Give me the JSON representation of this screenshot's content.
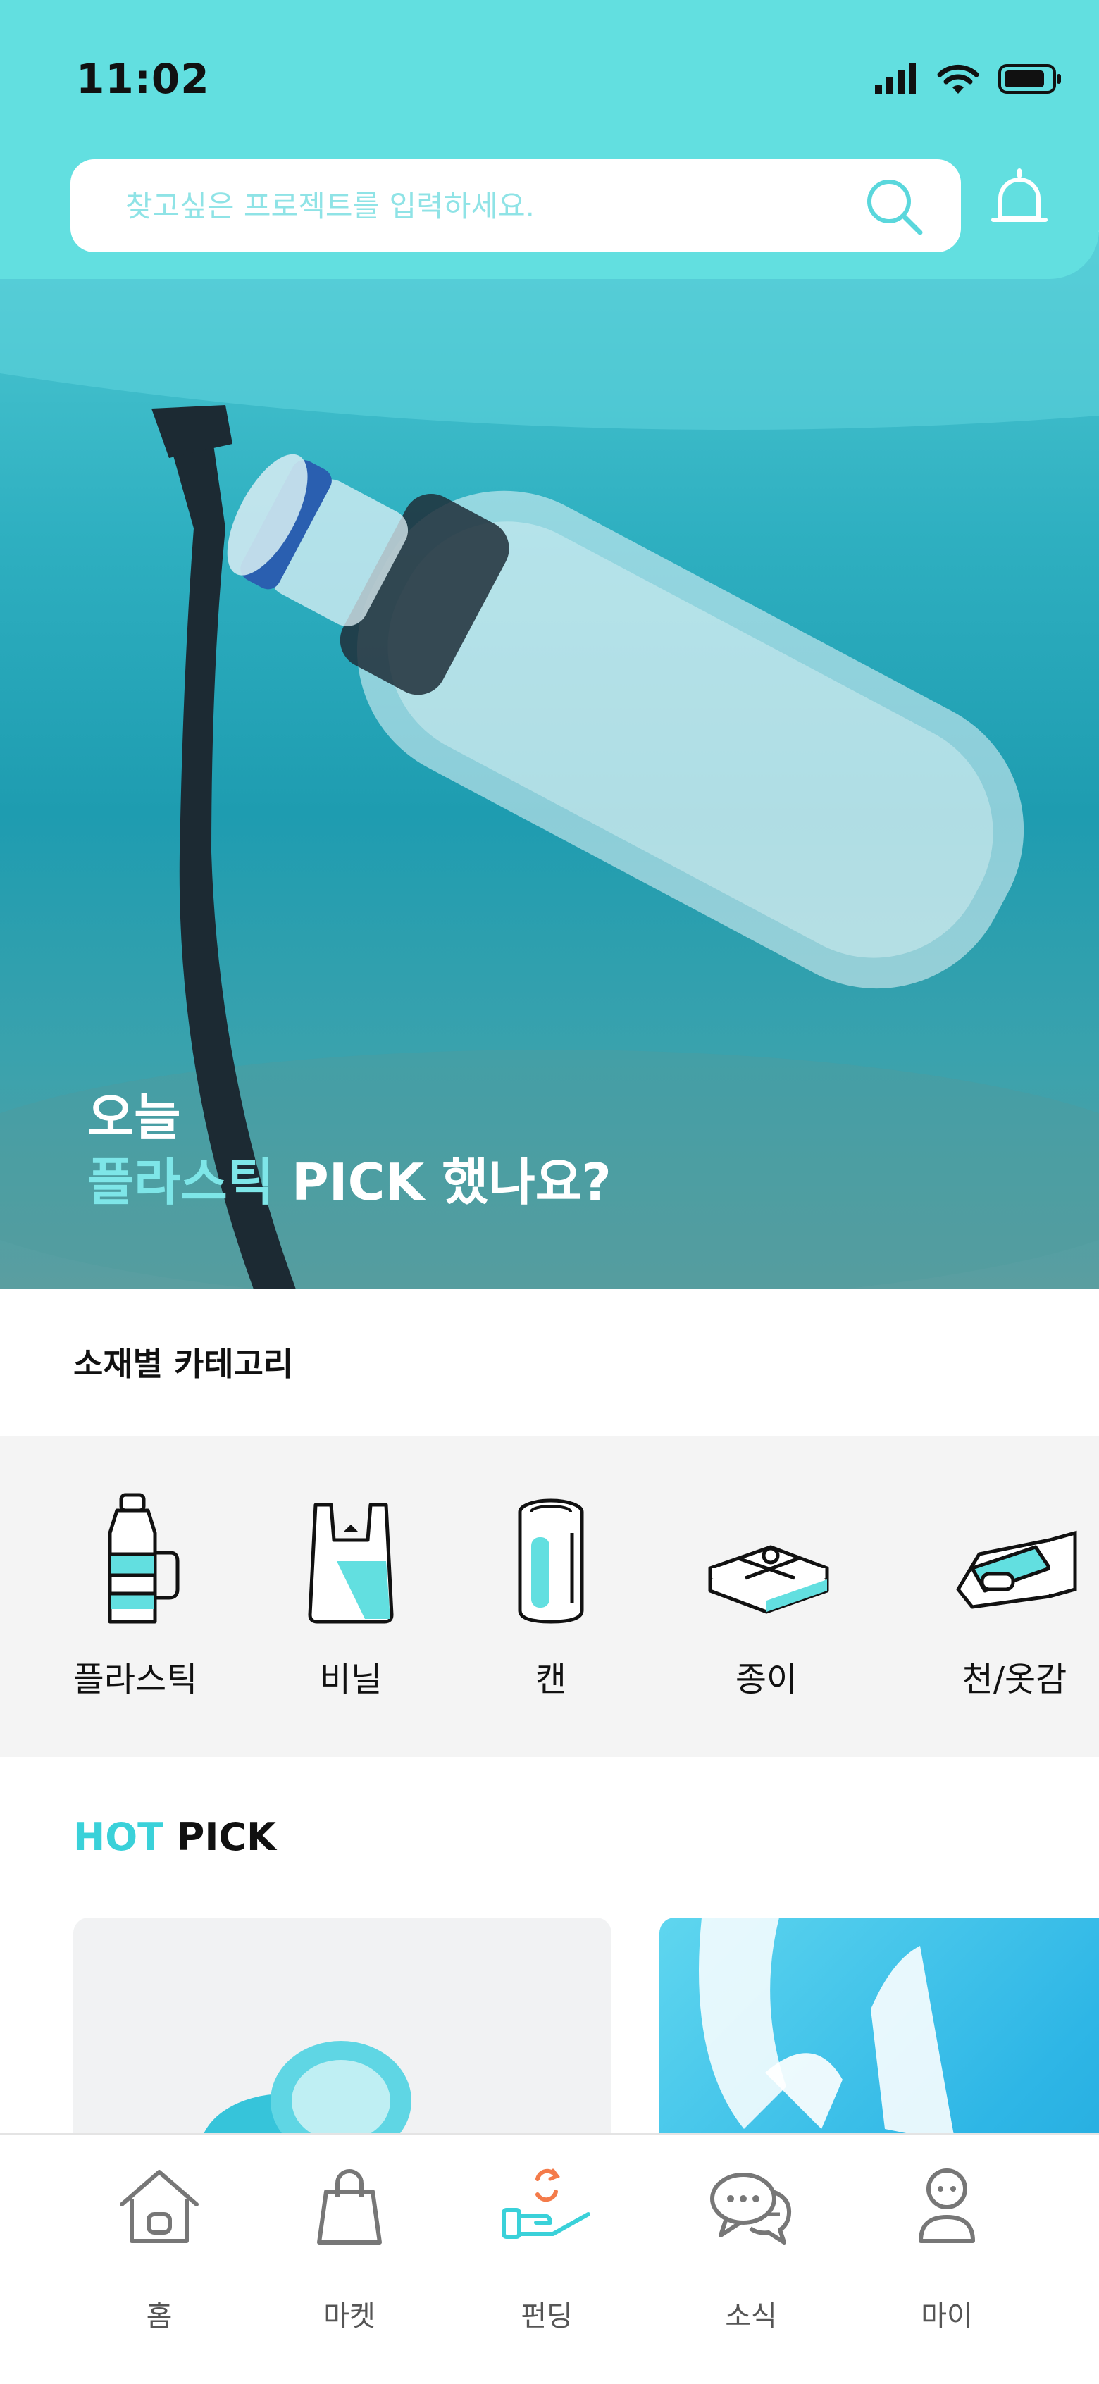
{
  "status_bar": {
    "time": "11:02"
  },
  "header": {
    "search": {
      "placeholder": "찾고싶은 프로젝트를 입력하세요."
    }
  },
  "hero": {
    "line1": "오늘",
    "line2_accent": "플라스틱",
    "line2_rest": " PICK 했나요?"
  },
  "categories": {
    "title": "소재별 카테고리",
    "items": [
      {
        "label": "플라스틱",
        "icon": "plastic-bottle-icon"
      },
      {
        "label": "비닐",
        "icon": "plastic-bag-icon"
      },
      {
        "label": "캔",
        "icon": "can-icon"
      },
      {
        "label": "종이",
        "icon": "paper-bundle-icon"
      },
      {
        "label": "천/옷감",
        "icon": "fabric-roll-icon"
      }
    ]
  },
  "hot_pick": {
    "title_accent": "HOT",
    "title_rest": " PICK"
  },
  "bottom_nav": {
    "items": [
      {
        "label": "홈",
        "icon": "home-icon"
      },
      {
        "label": "마켓",
        "icon": "shopping-bag-icon"
      },
      {
        "label": "펀딩",
        "icon": "funding-hand-icon",
        "active": true
      },
      {
        "label": "소식",
        "icon": "chat-bubbles-icon"
      },
      {
        "label": "마이",
        "icon": "person-icon"
      }
    ]
  },
  "colors": {
    "accent": "#62dfe0",
    "accent_text": "#3ad1d9",
    "funding_orange": "#f47b4a"
  }
}
